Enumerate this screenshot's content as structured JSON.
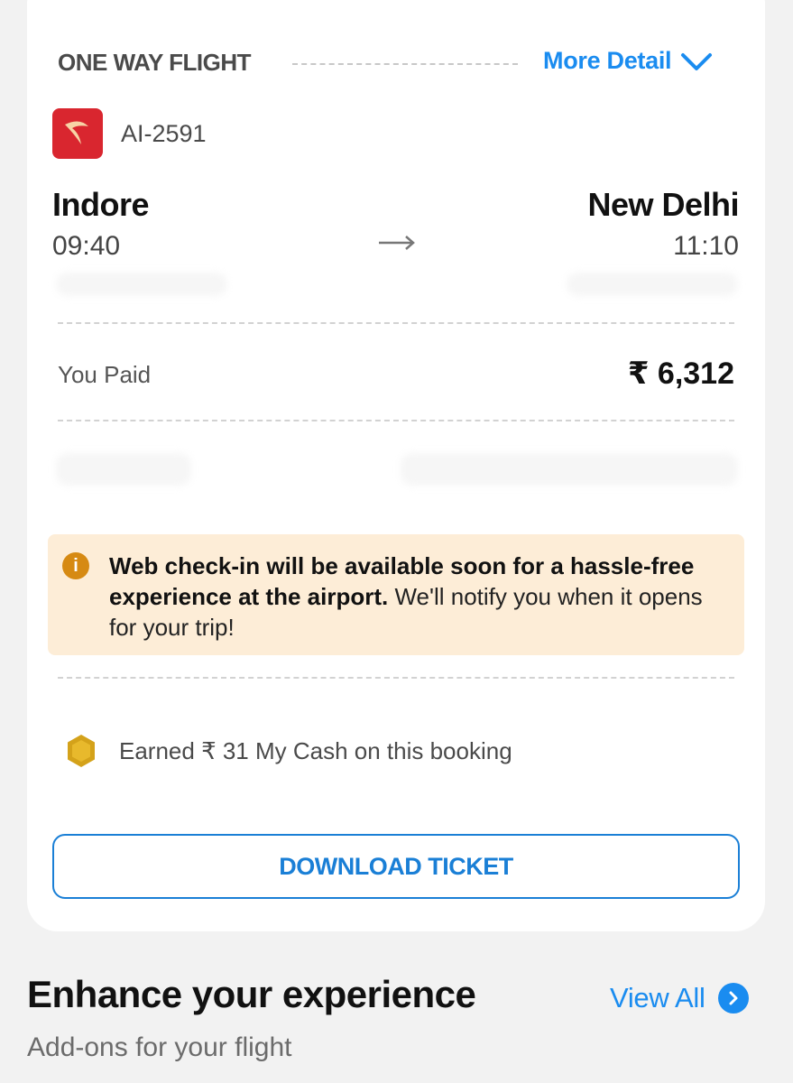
{
  "flight_card": {
    "type_label": "ONE WAY FLIGHT",
    "more_detail_label": "More Detail",
    "flight_number": "AI-2591",
    "origin": {
      "city": "Indore",
      "time": "09:40"
    },
    "destination": {
      "city": "New Delhi",
      "time": "11:10"
    },
    "paid_label": "You Paid",
    "paid_amount": "₹ 6,312",
    "notice": {
      "bold_text": "Web check-in will be available soon for a hassle-free experience at the airport.",
      "regular_text": " We'll notify you when it opens for your trip!"
    },
    "cash_earned": "Earned ₹ 31 My Cash on this booking",
    "download_label": "DOWNLOAD TICKET"
  },
  "enhance": {
    "title": "Enhance your experience",
    "subtitle": "Add-ons for your flight",
    "view_all_label": "View All"
  },
  "colors": {
    "accent_blue": "#1a8cf0",
    "notice_bg": "#fdedd7",
    "airline_red": "#d9262f",
    "coin_gold": "#d4a21a"
  }
}
